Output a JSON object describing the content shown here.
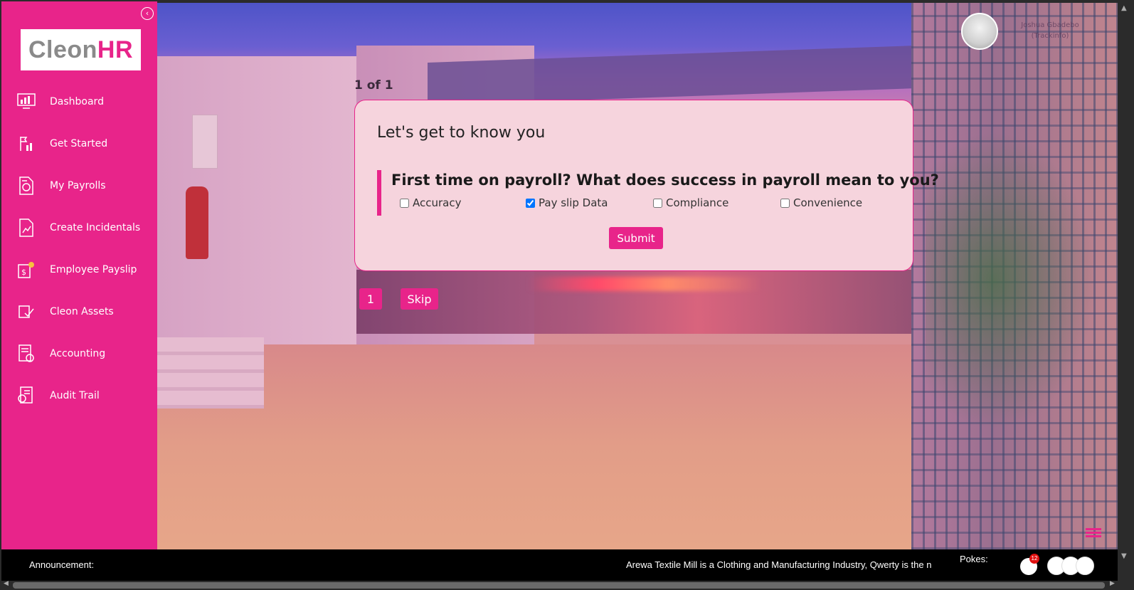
{
  "app": {
    "logo_part1": "Cleon",
    "logo_part2": "HR"
  },
  "sidebar": {
    "collapse_icon": "chevron-left-icon",
    "items": [
      {
        "label": "Dashboard",
        "icon": "dashboard-icon"
      },
      {
        "label": "Get Started",
        "icon": "get-started-icon"
      },
      {
        "label": "My Payrolls",
        "icon": "payrolls-icon"
      },
      {
        "label": "Create Incidentals",
        "icon": "incidentals-icon"
      },
      {
        "label": "Employee Payslip",
        "icon": "payslip-icon"
      },
      {
        "label": "Cleon Assets",
        "icon": "assets-icon"
      },
      {
        "label": "Accounting",
        "icon": "accounting-icon"
      },
      {
        "label": "Audit Trail",
        "icon": "audit-trail-icon"
      }
    ]
  },
  "header": {
    "user_name": "Joshua  Gbadebo (Trackinfo)"
  },
  "survey": {
    "counter": "1 of 1",
    "title": "Let's get to know you",
    "question": "First time on payroll? What does success in payroll mean to you?",
    "options": [
      {
        "label": "Accuracy",
        "checked": false
      },
      {
        "label": "Pay slip Data",
        "checked": true
      },
      {
        "label": "Compliance",
        "checked": false
      },
      {
        "label": "Convenience",
        "checked": false
      }
    ],
    "submit_label": "Submit",
    "page_number": "1",
    "skip_label": "Skip"
  },
  "bottom_bar": {
    "announcement_label": "Announcement:",
    "announcement_text": "Arewa Textile Mill is a Clothing and Manufacturing Industry, Qwerty is the n",
    "pokes_label": "Pokes:",
    "pokes_count": "12"
  },
  "colors": {
    "accent": "#e8248a",
    "bar": "#000000"
  }
}
